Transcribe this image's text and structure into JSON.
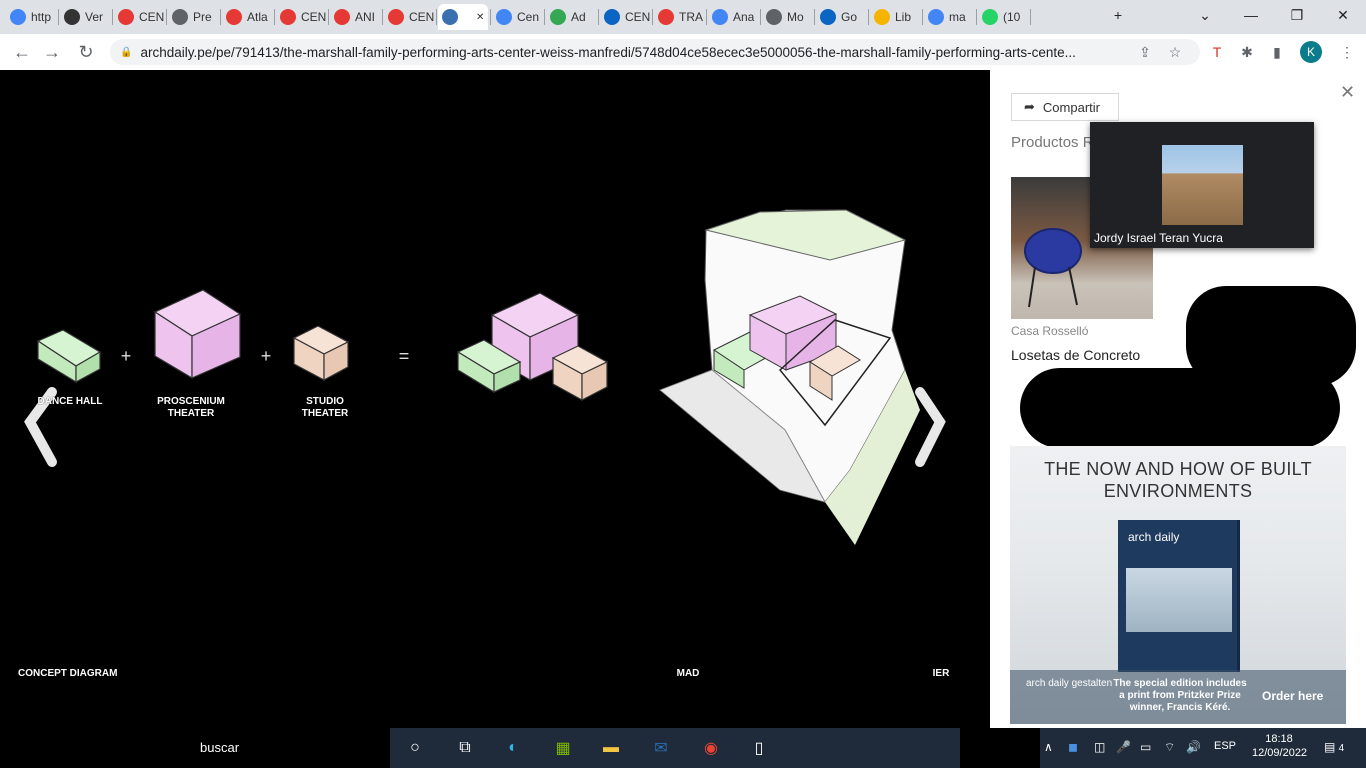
{
  "tabs": [
    {
      "title": "http",
      "favicon": "google",
      "color": "#4285f4"
    },
    {
      "title": "Ver",
      "favicon": "archdaily",
      "color": "#333"
    },
    {
      "title": "CEN",
      "favicon": "target",
      "color": "#e53935"
    },
    {
      "title": "Pre",
      "favicon": "globe",
      "color": "#5f6368"
    },
    {
      "title": "Atla",
      "favicon": "target",
      "color": "#e53935"
    },
    {
      "title": "CEN",
      "favicon": "target",
      "color": "#e53935"
    },
    {
      "title": "ANI",
      "favicon": "target",
      "color": "#e53935"
    },
    {
      "title": "CEN",
      "favicon": "target",
      "color": "#e53935"
    },
    {
      "title": "",
      "favicon": "archdaily",
      "color": "#3a6fb0",
      "active": true
    },
    {
      "title": "Cen",
      "favicon": "google",
      "color": "#4285f4"
    },
    {
      "title": "Ad",
      "favicon": "maps",
      "color": "#34a853"
    },
    {
      "title": "CEN",
      "favicon": "edge",
      "color": "#0a66c2"
    },
    {
      "title": "TRA",
      "favicon": "target",
      "color": "#e53935"
    },
    {
      "title": "Ana",
      "favicon": "docs",
      "color": "#4285f4"
    },
    {
      "title": "Mo",
      "favicon": "globe",
      "color": "#5f6368"
    },
    {
      "title": "Go",
      "favicon": "edge",
      "color": "#0a66c2"
    },
    {
      "title": "Lib",
      "favicon": "note",
      "color": "#f4b400"
    },
    {
      "title": "ma",
      "favicon": "google",
      "color": "#4285f4"
    },
    {
      "title": "(10",
      "favicon": "whatsapp",
      "color": "#25d366"
    }
  ],
  "toolbar": {
    "url": "archdaily.pe/pe/791413/the-marshall-family-performing-arts-center-weiss-manfredi/5748d04ce58ecec3e5000056-the-marshall-family-performing-arts-cente...",
    "avatar_letter": "K"
  },
  "viewer": {
    "labels": {
      "dance_hall": "DANCE HALL",
      "proscenium": "PROSCENIUM\nTHEATER",
      "studio": "STUDIO\nTHEATER",
      "concept": "CONCEPT DIAGRAM",
      "mid_caption": "MAD",
      "right_caption": "IER"
    },
    "operators": {
      "plus": "+",
      "equals": "="
    }
  },
  "side": {
    "share_label": "Compartir",
    "products_heading": "Productos R",
    "product_brand": "Casa Rosselló",
    "product_name": "Losetas de Concreto",
    "meet_name": "Jordy Israel Teran Yucra",
    "ad": {
      "title": "THE NOW AND HOW OF BUILT ENVIRONMENTS",
      "book_brand": "arch daily",
      "logo": "arch daily gestalten",
      "text": "The special edition includes a print from Pritzker Prize winner, Francis Kéré.",
      "cta": "Order here"
    }
  },
  "taskbar": {
    "search": "buscar",
    "lang": "ESP",
    "time": "18:18",
    "date": "12/09/2022",
    "notifications": "4"
  }
}
